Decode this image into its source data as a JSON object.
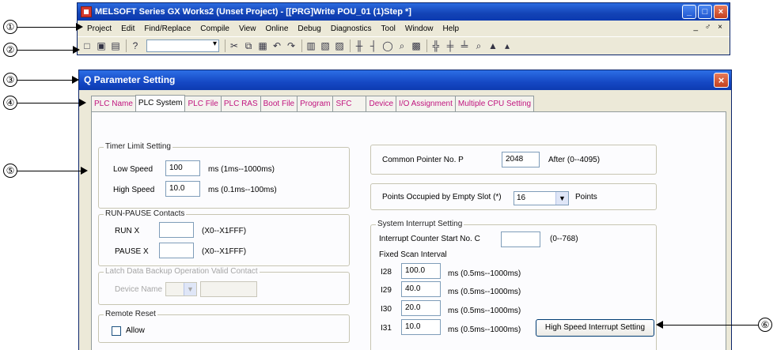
{
  "window": {
    "title": "MELSOFT Series GX Works2 (Unset Project) - [[PRG]Write POU_01 (1)Step *]",
    "controls": [
      "_",
      "□",
      "×"
    ],
    "menu": [
      "Project",
      "Edit",
      "Find/Replace",
      "Compile",
      "View",
      "Online",
      "Debug",
      "Diagnostics",
      "Tool",
      "Window",
      "Help"
    ],
    "menu_right": "_ ♂ ×",
    "toolbar_icons": [
      "new-icon",
      "open-icon",
      "save-icon",
      "help-icon",
      "cut-icon",
      "copy-icon",
      "paste-icon",
      "undo-icon",
      "redo-icon",
      "monitor-icon",
      "write-icon",
      "read-icon",
      "ladder-icon",
      "contact-icon",
      "coil-icon",
      "zoom-icon",
      "device-icon"
    ]
  },
  "callouts": [
    "①",
    "②",
    "③",
    "④",
    "⑤",
    "⑥"
  ],
  "dialog": {
    "title": "Q Parameter Setting",
    "tabs": [
      "PLC Name",
      "PLC System",
      "PLC File",
      "PLC RAS",
      "Boot File",
      "Program",
      "SFC",
      "Device",
      "I/O Assignment",
      "Multiple CPU Setting"
    ],
    "active_tab": "PLC System",
    "timer": {
      "title": "Timer Limit Setting",
      "low_label": "Low Speed",
      "low_value": "100",
      "low_unit": "ms  (1ms--1000ms)",
      "high_label": "High Speed",
      "high_value": "10.0",
      "high_unit": "ms  (0.1ms--100ms)"
    },
    "run_pause": {
      "title": "RUN-PAUSE Contacts",
      "run_label": "RUN    X",
      "run_range": "(X0--X1FFF)",
      "pause_label": "PAUSE  X",
      "pause_range": "(X0--X1FFF)"
    },
    "latch": {
      "title": "Latch Data Backup Operation Valid Contact",
      "device_label": "Device Name"
    },
    "remote_reset": {
      "title": "Remote Reset",
      "allow_label": "Allow"
    },
    "common_pointer": {
      "label": "Common Pointer No.   P",
      "value": "2048",
      "after": "After    (0--4095)"
    },
    "empty_slot": {
      "label": "Points Occupied by Empty Slot  (*)",
      "value": "16",
      "unit": "Points"
    },
    "interrupt": {
      "title": "System Interrupt Setting",
      "counter_label": "Interrupt Counter Start No.  C",
      "counter_range": "(0--768)",
      "fixed_label": "Fixed Scan Interval",
      "rows": [
        {
          "id": "I28",
          "value": "100.0",
          "unit": "ms  (0.5ms--1000ms)"
        },
        {
          "id": "I29",
          "value": "40.0",
          "unit": "ms  (0.5ms--1000ms)"
        },
        {
          "id": "I30",
          "value": "20.0",
          "unit": "ms  (0.5ms--1000ms)"
        },
        {
          "id": "I31",
          "value": "10.0",
          "unit": "ms  (0.5ms--1000ms)"
        }
      ],
      "high_speed_button": "High Speed Interrupt Setting"
    }
  }
}
